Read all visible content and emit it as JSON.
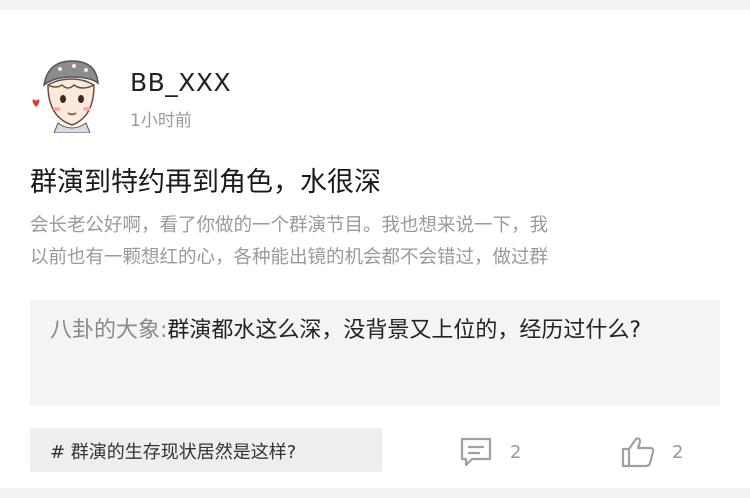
{
  "post": {
    "author": {
      "username": "BB_XXX",
      "timestamp": "1小时前",
      "avatar_icon": "cartoon-boy-avatar-icon"
    },
    "title": "群演到特约再到角色，水很深",
    "excerpt_lines": [
      "会长老公好啊，看了你做的一个群演节目。我也想来说一下，我",
      "以前也有一颗想红的心，各种能出镜的机会都不会错过，做过群"
    ],
    "quote": {
      "author": "八卦的大象:",
      "text": "群演都水这么深，没背景又上位的，经历过什么?"
    },
    "topic": "# 群演的生存现状居然是这样?",
    "actions": {
      "comment_icon": "comment-bubble-icon",
      "comment_count": "2",
      "like_icon": "thumbs-up-icon",
      "like_count": "2"
    }
  },
  "colors": {
    "quote_background": "#f4f4f4",
    "topic_background": "#eeeeee",
    "muted_text": "#9a9a9a",
    "primary_text": "#222222"
  }
}
